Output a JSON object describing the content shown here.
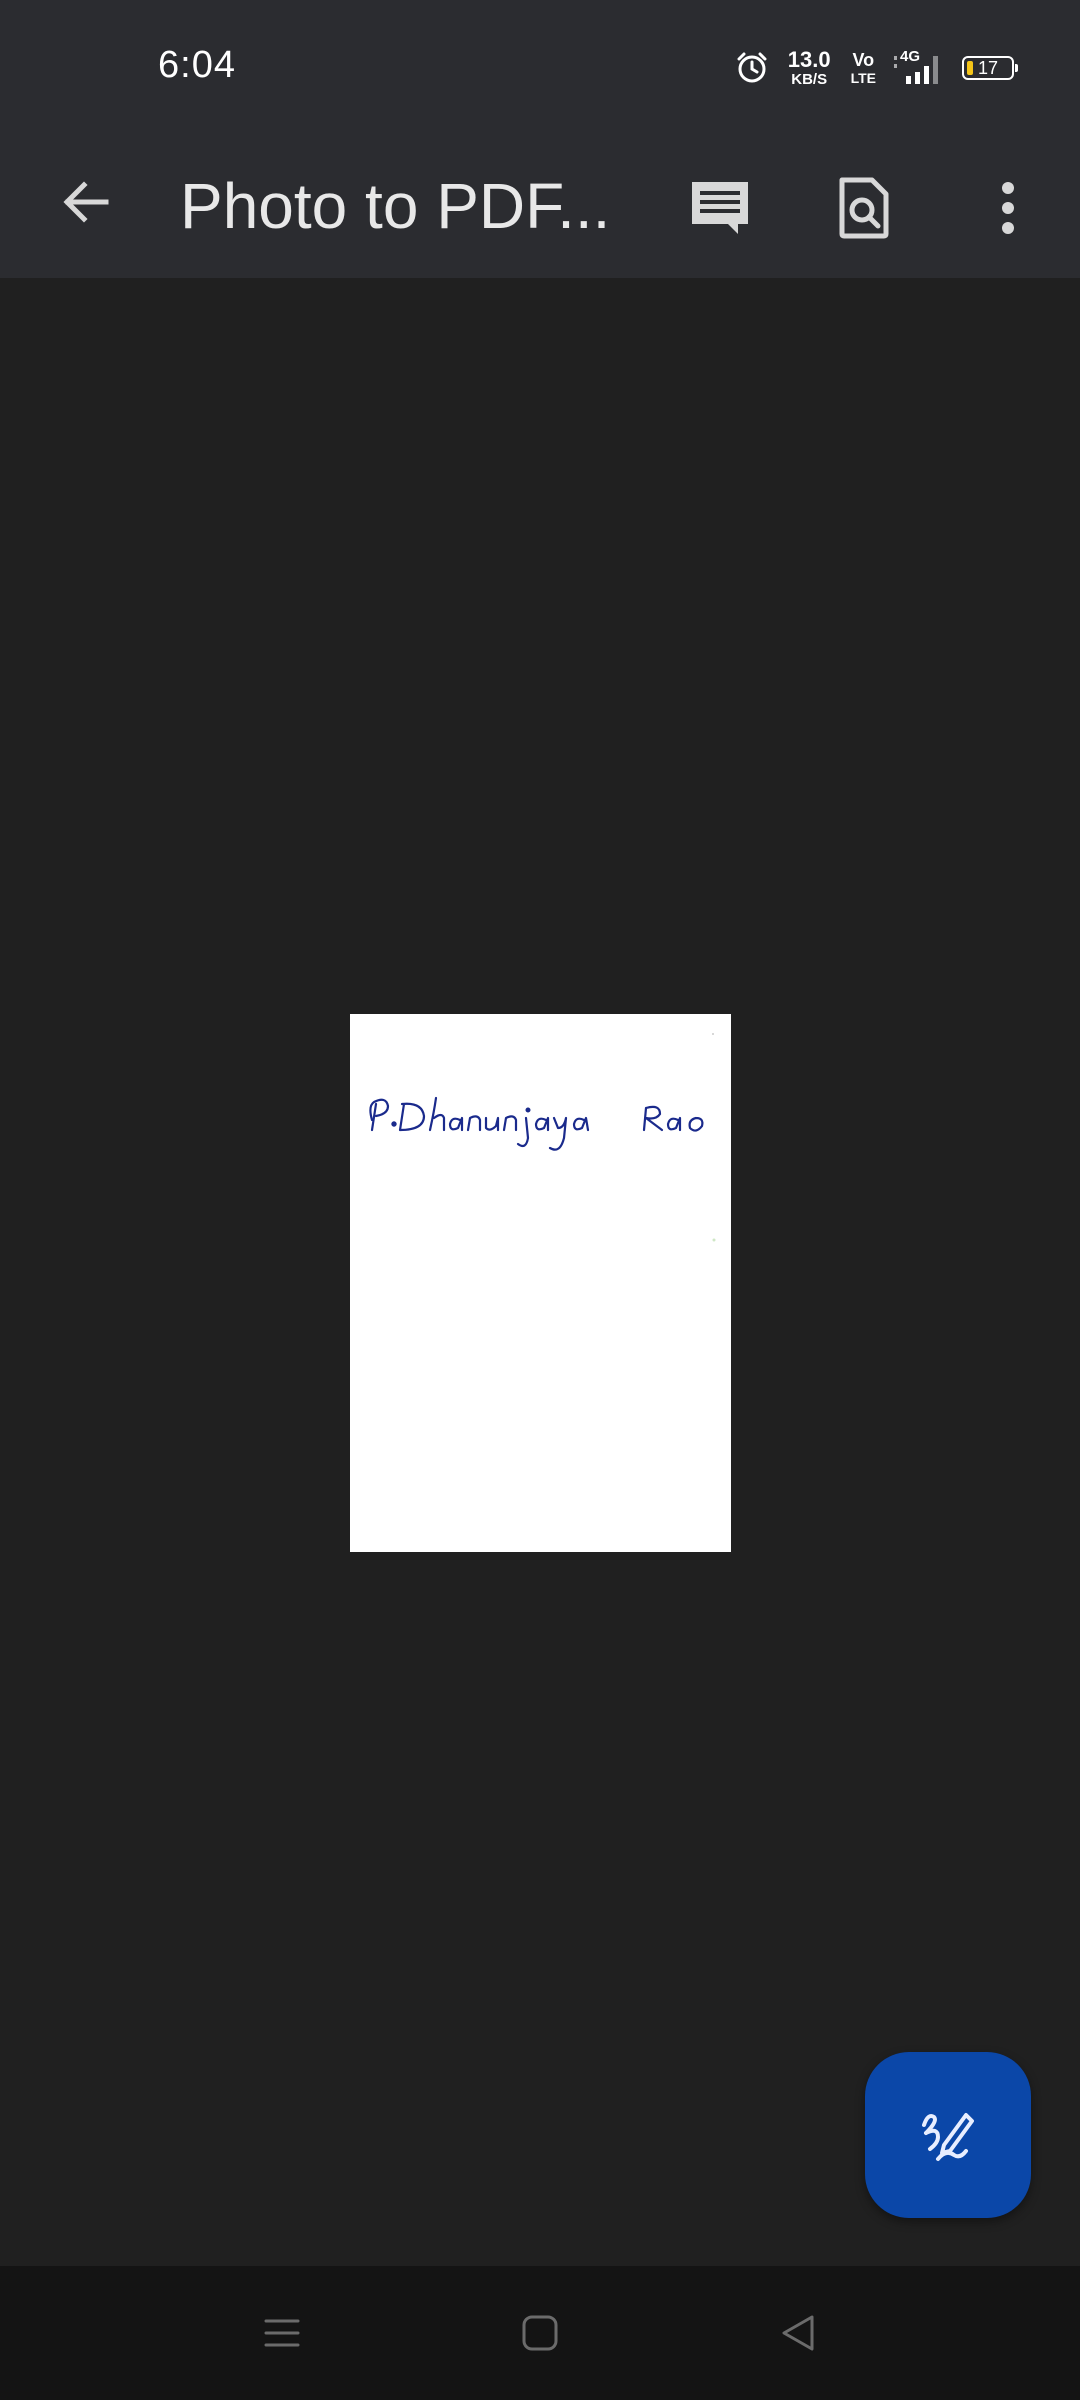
{
  "status_bar": {
    "time": "6:04",
    "net_speed_value": "13.0",
    "net_speed_unit": "KB/S",
    "volte_top": "Vo",
    "volte_bottom": "LTE",
    "network_type": "4G",
    "battery_level": "17"
  },
  "app_bar": {
    "title": "Photo to PDF...",
    "icons": {
      "back": "arrow-back-icon",
      "comments": "comment-icon",
      "find": "find-in-page-icon",
      "more": "more-vert-icon"
    }
  },
  "document": {
    "signature_text": "P.Dhanunjaya Rao"
  },
  "fab": {
    "icon": "signature-pen-icon",
    "color": "#0b47a8"
  },
  "nav_bar": {
    "icons": [
      "menu-icon",
      "home-icon",
      "back-triangle-icon"
    ]
  },
  "colors": {
    "app_bar": "#2b2c30",
    "viewer_background": "#202020",
    "signature_ink": "#1a2a8c"
  }
}
